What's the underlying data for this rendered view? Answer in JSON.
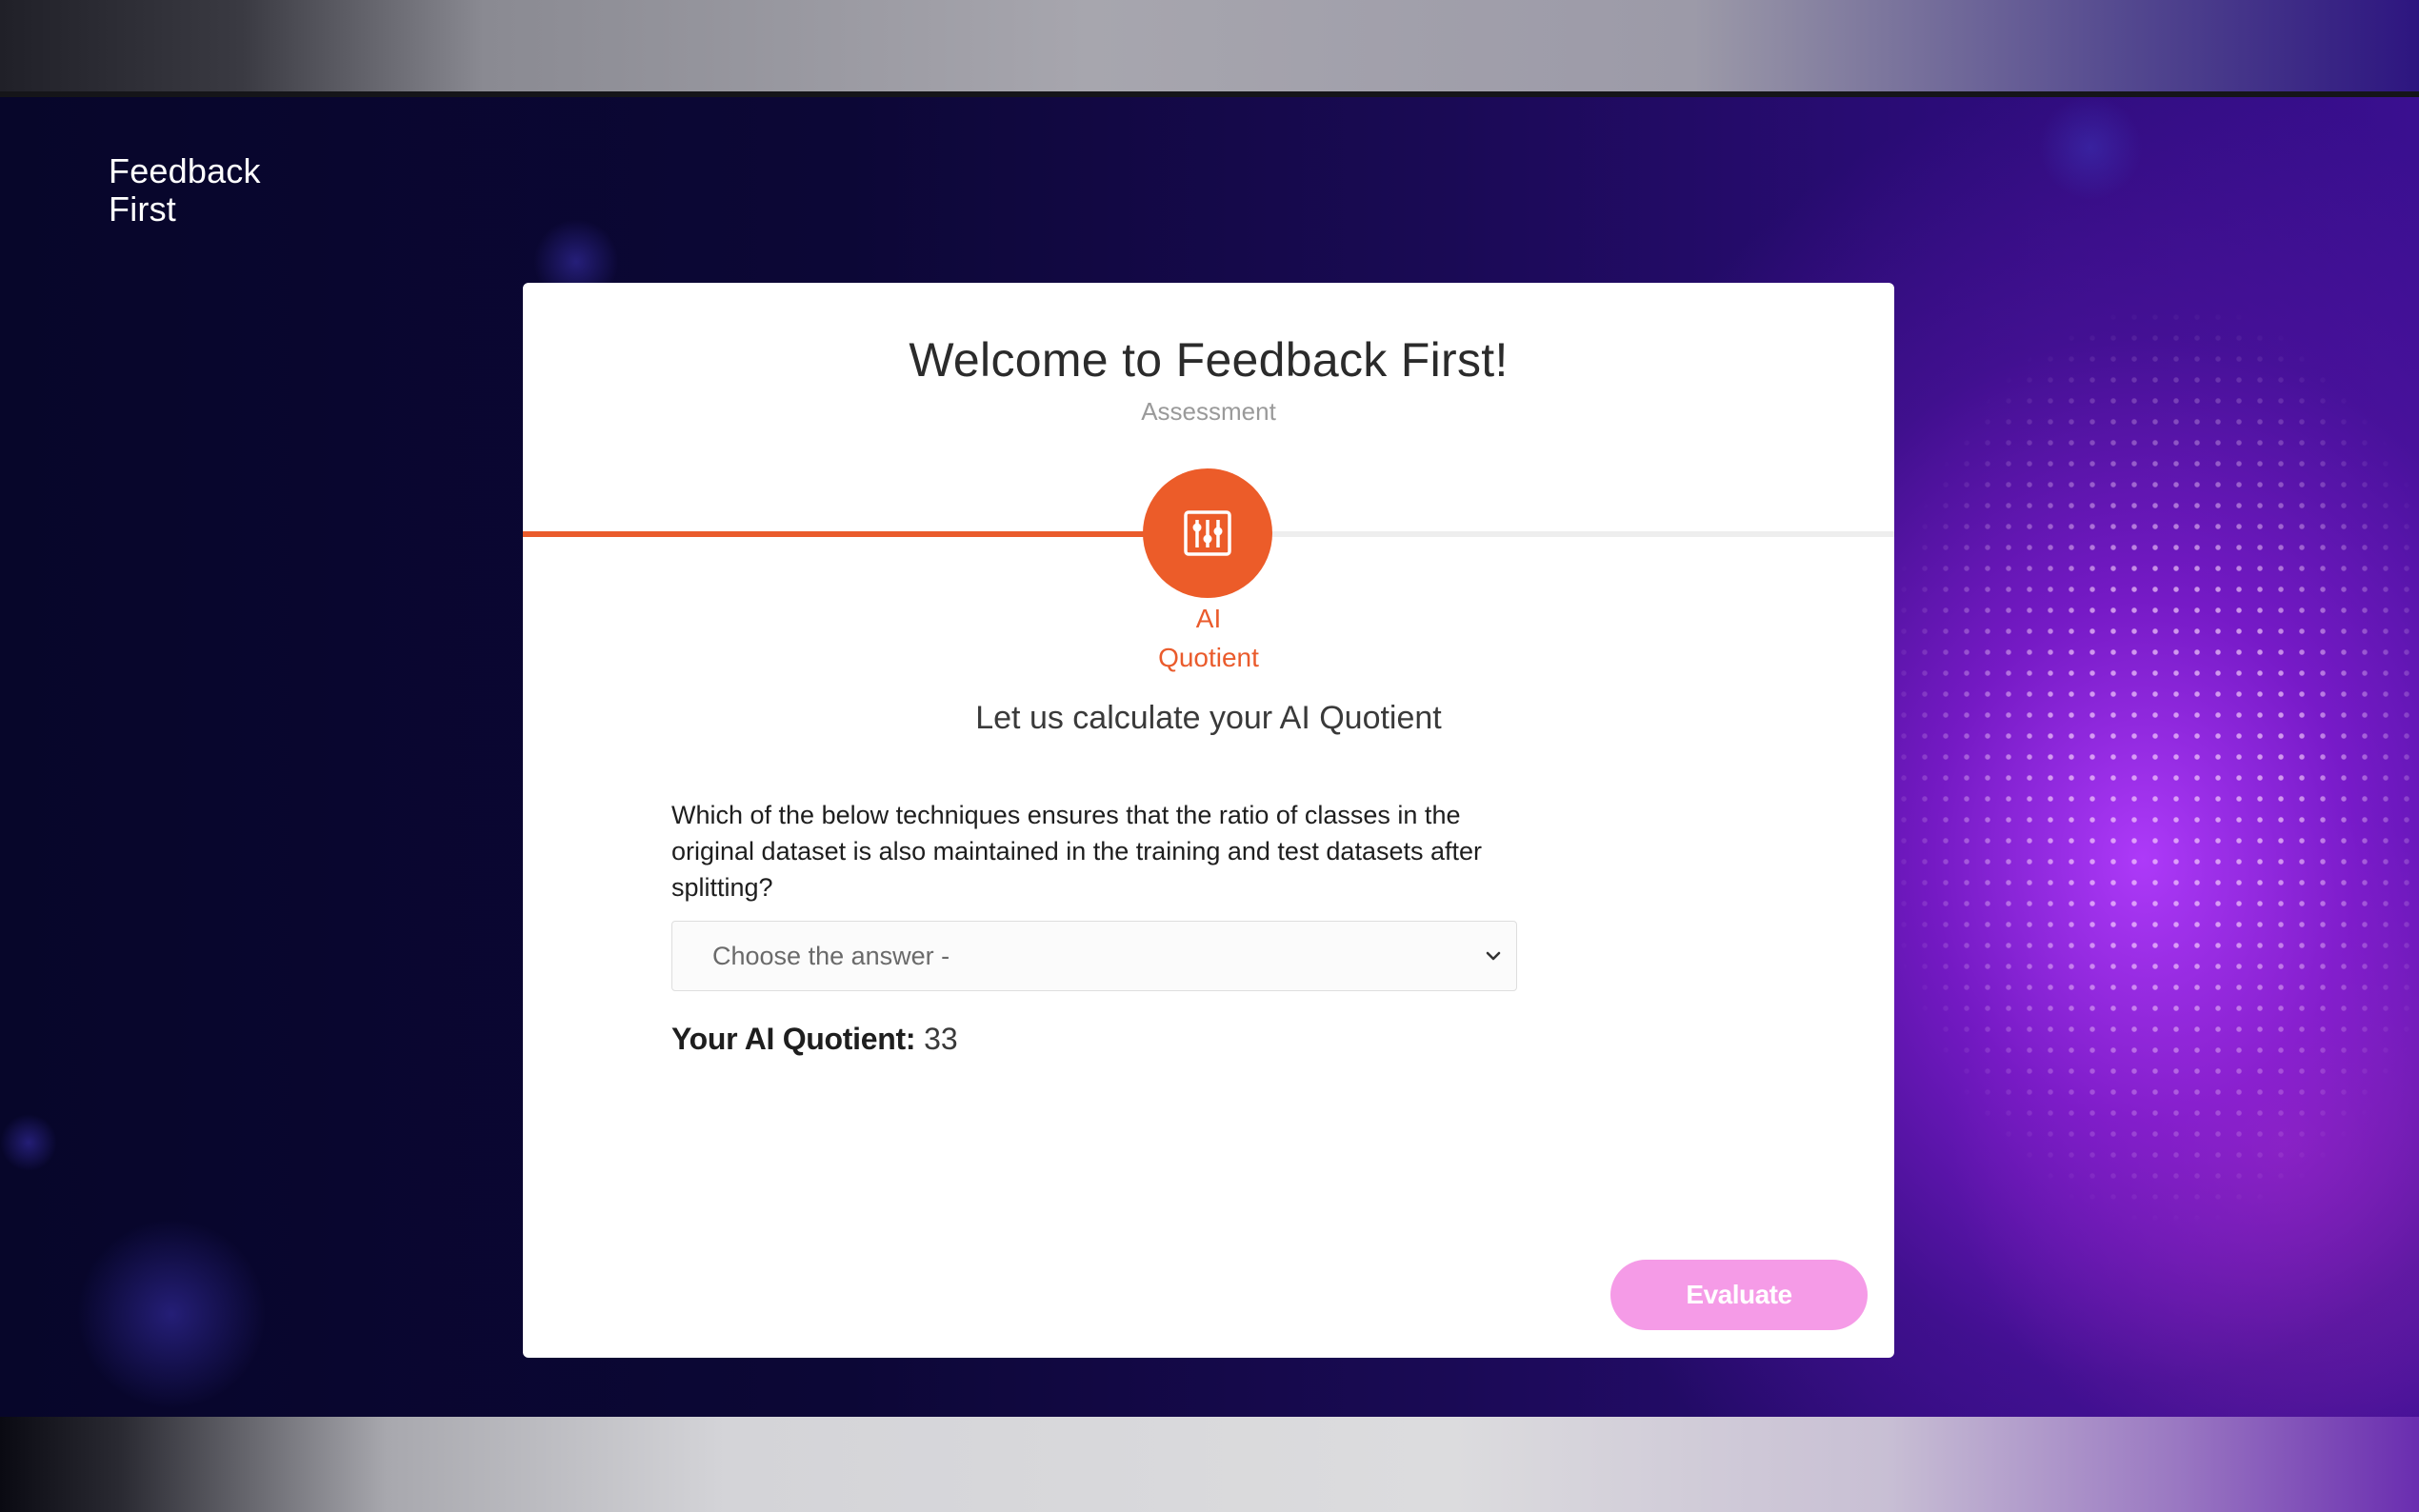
{
  "brand": {
    "line1": "Feedback",
    "line2": "First"
  },
  "card": {
    "title": "Welcome to Feedback First!",
    "subtitle": "Assessment",
    "progress_fraction": 0.455,
    "step": {
      "icon": "sliders-icon",
      "label_line1": "AI",
      "label_line2": "Quotient"
    },
    "lead": "Let us calculate your AI Quotient",
    "question": "Which of the below techniques ensures that the ratio of classes in the original dataset is also maintained in the training and test datasets after splitting?",
    "answer_select": {
      "value": "Choose the answer -"
    },
    "score": {
      "label": "Your AI Quotient:",
      "value": "33"
    },
    "evaluate_label": "Evaluate"
  },
  "colors": {
    "accent": "#ec5c29",
    "evaluate_button": "#f59be7",
    "card_background": "#ffffff"
  }
}
